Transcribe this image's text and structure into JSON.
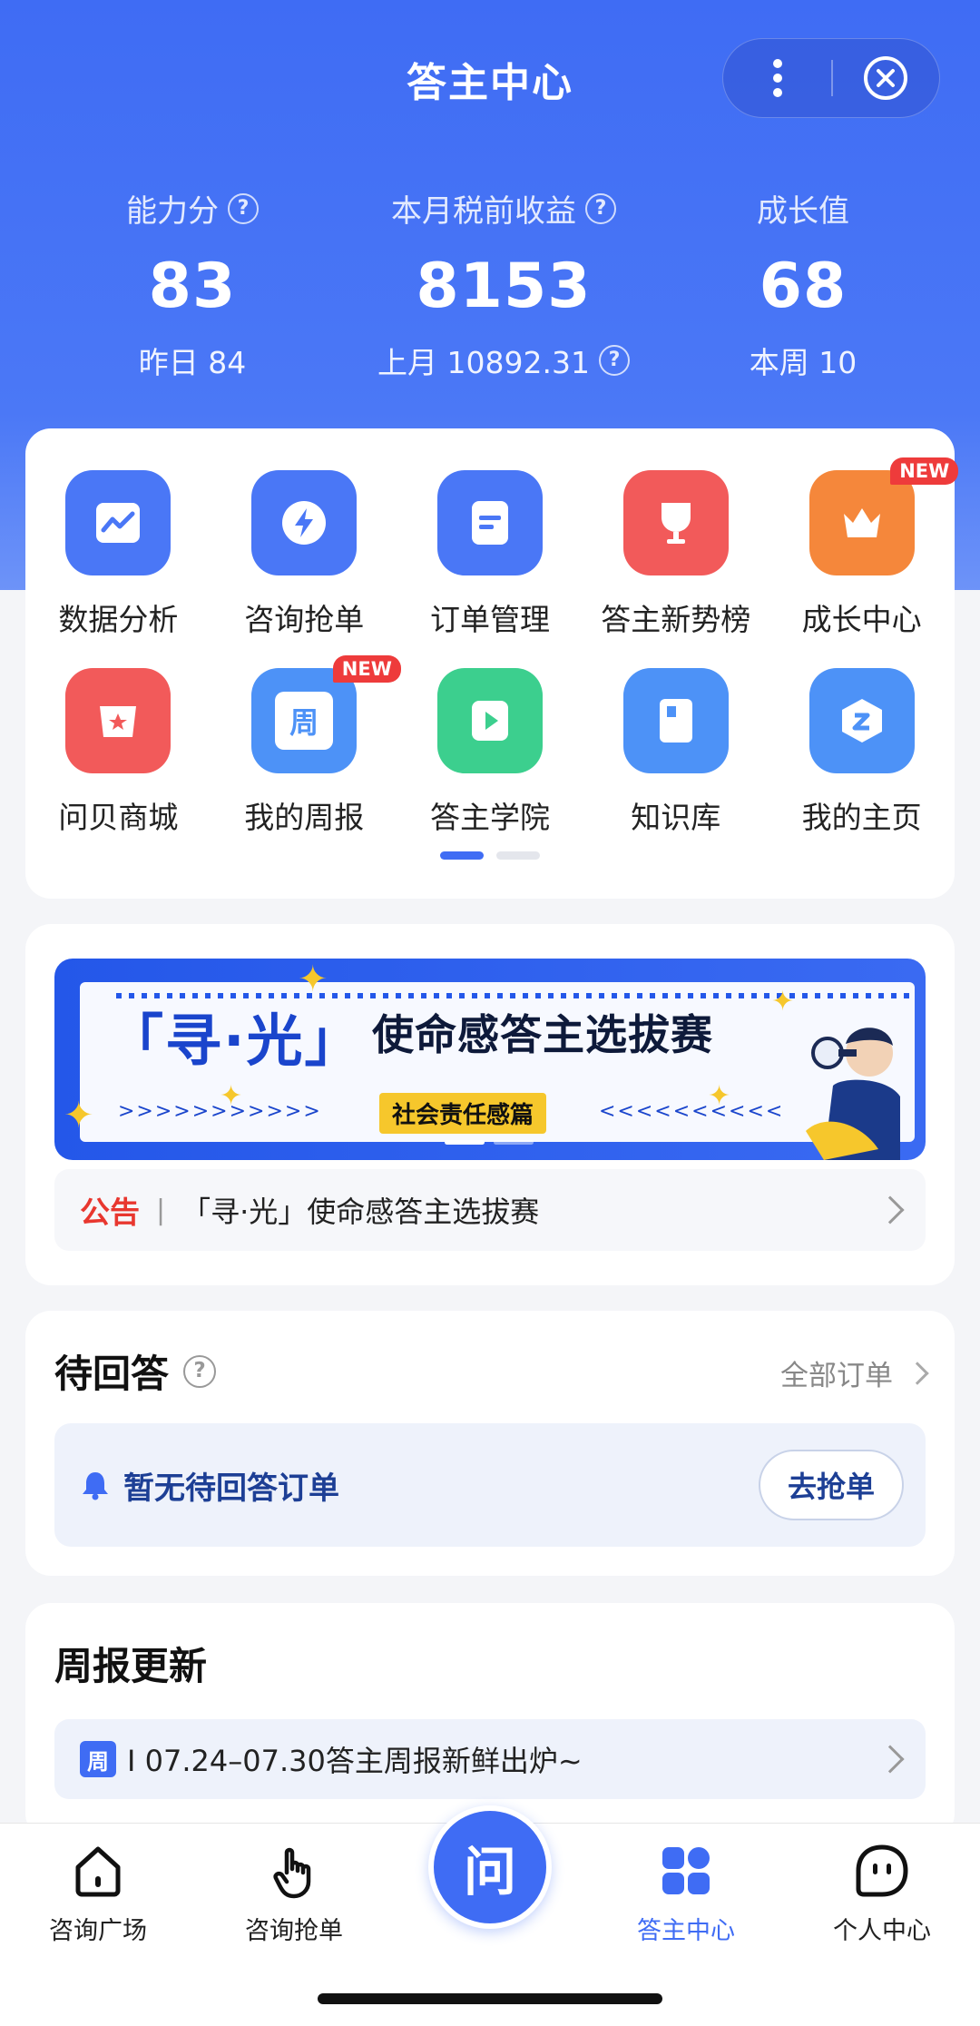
{
  "header": {
    "title": "答主中心"
  },
  "stats": [
    {
      "label": "能力分",
      "value": "83",
      "sub": "昨日 84",
      "has_help": true
    },
    {
      "label": "本月税前收益",
      "value": "8153",
      "sub": "上月 10892.31",
      "has_help": true
    },
    {
      "label": "成长值",
      "value": "68",
      "sub": "本周 10",
      "has_help": false
    }
  ],
  "quick_grid": {
    "items": [
      {
        "label": "数据分析",
        "icon": "chart-icon",
        "color": "#4a77f6"
      },
      {
        "label": "咨询抢单",
        "icon": "lightning-icon",
        "color": "#4a77f6"
      },
      {
        "label": "订单管理",
        "icon": "document-icon",
        "color": "#4a77f6"
      },
      {
        "label": "答主新势榜",
        "icon": "trophy-icon",
        "color": "#f25a5a"
      },
      {
        "label": "成长中心",
        "icon": "crown-icon",
        "color": "#f5873b",
        "badge": "NEW"
      },
      {
        "label": "问贝商城",
        "icon": "shop-icon",
        "color": "#f25a5a"
      },
      {
        "label": "我的周报",
        "icon": "calendar-icon",
        "color": "#4d92f7",
        "badge": "NEW",
        "glyph": "周"
      },
      {
        "label": "答主学院",
        "icon": "play-icon",
        "color": "#3ccf8e"
      },
      {
        "label": "知识库",
        "icon": "book-icon",
        "color": "#4d92f7"
      },
      {
        "label": "我的主页",
        "icon": "profile-icon",
        "color": "#4d92f7"
      }
    ],
    "page_count": 2,
    "active_page": 1
  },
  "banner": {
    "title": "「寻·光」",
    "subtitle": "使命感答主选拔赛",
    "tag": "社会责任感篇"
  },
  "notice": {
    "tag": "公告",
    "text": "「寻·光」使命感答主选拔赛"
  },
  "pending": {
    "title": "待回答",
    "all_orders": "全部订单",
    "empty_text": "暂无待回答订单",
    "grab_button": "去抢单"
  },
  "weekly": {
    "title": "周报更新",
    "icon_glyph": "周",
    "text": "I 07.24–07.30答主周报新鲜出炉~"
  },
  "tabbar": {
    "tabs": [
      {
        "label": "咨询广场",
        "icon": "home-icon"
      },
      {
        "label": "咨询抢单",
        "icon": "tap-icon"
      },
      {
        "label": "答主中心",
        "icon": "grid-apps-icon",
        "active": true
      },
      {
        "label": "个人中心",
        "icon": "face-icon"
      }
    ],
    "center_glyph": "问"
  },
  "colors": {
    "primary": "#3f6cf4",
    "danger": "#e8372f",
    "banner_yellow": "#f6c72c"
  }
}
